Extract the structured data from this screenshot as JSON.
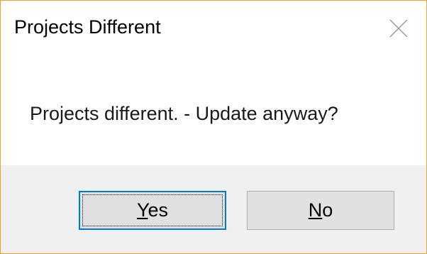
{
  "dialog": {
    "title": "Projects Different",
    "message": "Projects different. - Update anyway?",
    "close_icon": "close-icon",
    "accent_border_color": "#f0a030",
    "buttons": {
      "yes": {
        "mnemonic": "Y",
        "rest": "es"
      },
      "no": {
        "mnemonic": "N",
        "rest": "o"
      }
    }
  }
}
